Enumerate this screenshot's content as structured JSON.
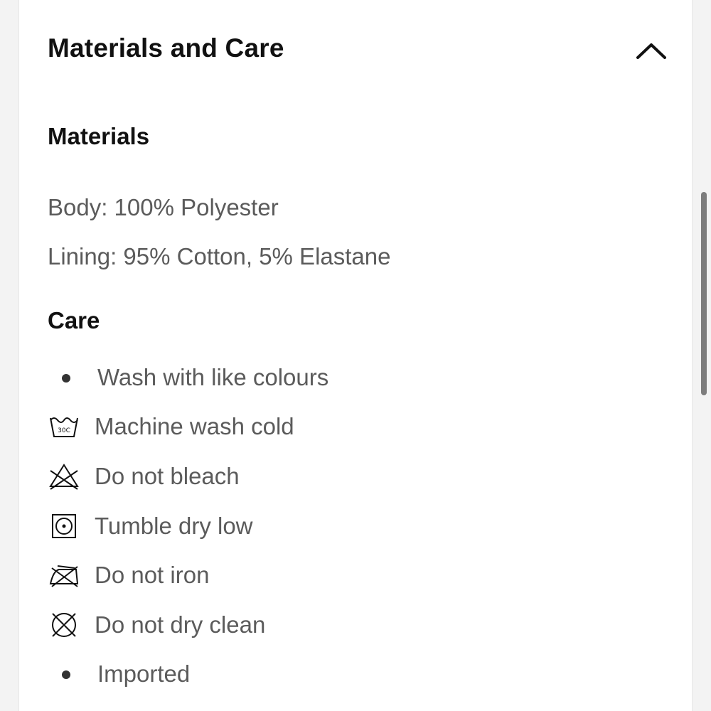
{
  "accordion": {
    "title": "Materials and Care",
    "state_icon": "chevron-up-icon"
  },
  "materials": {
    "heading": "Materials",
    "lines": [
      "Body: 100% Polyester",
      "Lining: 95% Cotton, 5% Elastane"
    ]
  },
  "care": {
    "heading": "Care",
    "items": [
      {
        "icon": "bullet",
        "label": "Wash with like colours"
      },
      {
        "icon": "machine-wash-30c-icon",
        "label": "Machine wash cold",
        "icon_text": "30C"
      },
      {
        "icon": "do-not-bleach-icon",
        "label": "Do not bleach"
      },
      {
        "icon": "tumble-dry-low-icon",
        "label": "Tumble dry low"
      },
      {
        "icon": "do-not-iron-icon",
        "label": "Do not iron"
      },
      {
        "icon": "do-not-dry-clean-icon",
        "label": "Do not dry clean"
      },
      {
        "icon": "bullet",
        "label": "Imported"
      }
    ]
  },
  "colors": {
    "heading_text": "#111111",
    "body_text": "#5b5b5b",
    "panel_bg": "#ffffff",
    "page_bg": "#f3f3f3",
    "scrollbar": "#7d7d7d"
  }
}
